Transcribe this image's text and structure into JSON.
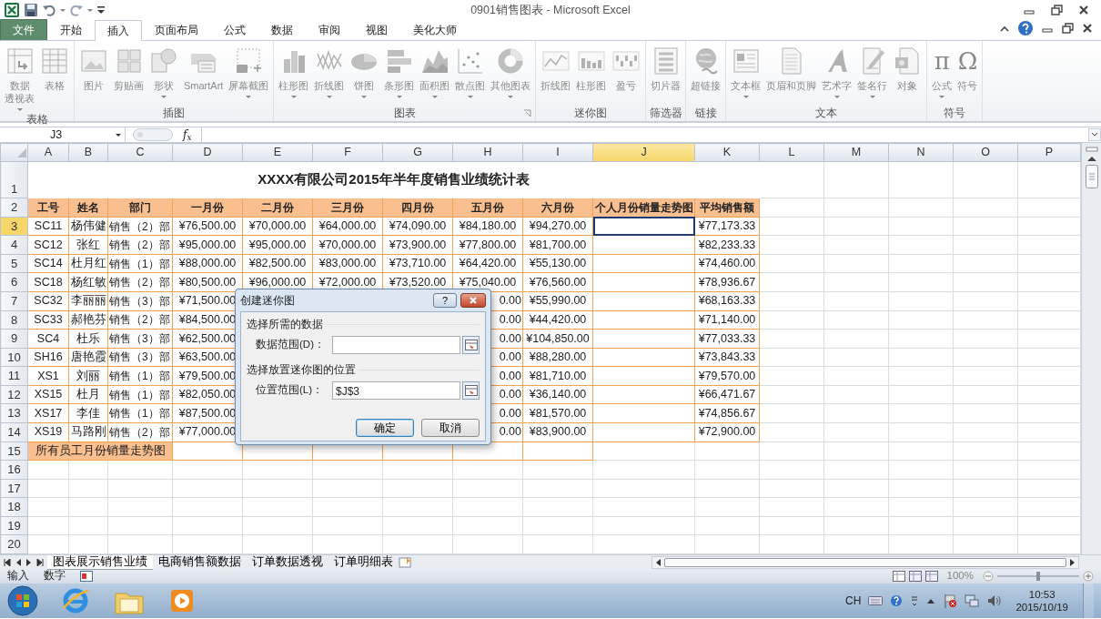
{
  "window": {
    "title": "0901销售图表 - Microsoft Excel"
  },
  "ribbon_tabs": [
    {
      "label": "文件",
      "kind": "file",
      "selected": false
    },
    {
      "label": "开始",
      "kind": "tab",
      "selected": false
    },
    {
      "label": "插入",
      "kind": "tab",
      "selected": true
    },
    {
      "label": "页面布局",
      "kind": "tab",
      "selected": false
    },
    {
      "label": "公式",
      "kind": "tab",
      "selected": false
    },
    {
      "label": "数据",
      "kind": "tab",
      "selected": false
    },
    {
      "label": "审阅",
      "kind": "tab",
      "selected": false
    },
    {
      "label": "视图",
      "kind": "tab",
      "selected": false
    },
    {
      "label": "美化大师",
      "kind": "tab",
      "selected": false
    }
  ],
  "ribbon": {
    "disabled": true,
    "groups": [
      {
        "label": "表格",
        "dialog_launcher": false,
        "buttons": [
          {
            "lines": [
              "数据",
              "透视表"
            ],
            "dropdown": true
          },
          {
            "lines": [
              "表格"
            ],
            "dropdown": false
          }
        ]
      },
      {
        "label": "插图",
        "dialog_launcher": false,
        "buttons": [
          {
            "lines": [
              "图片"
            ],
            "dropdown": false
          },
          {
            "lines": [
              "剪贴画"
            ],
            "dropdown": false
          },
          {
            "lines": [
              "形状"
            ],
            "dropdown": true
          },
          {
            "lines": [
              "SmartArt"
            ],
            "dropdown": false
          },
          {
            "lines": [
              "屏幕截图"
            ],
            "dropdown": true
          }
        ]
      },
      {
        "label": "图表",
        "dialog_launcher": true,
        "buttons": [
          {
            "lines": [
              "柱形图"
            ],
            "dropdown": true
          },
          {
            "lines": [
              "折线图"
            ],
            "dropdown": true
          },
          {
            "lines": [
              "饼图"
            ],
            "dropdown": true
          },
          {
            "lines": [
              "条形图"
            ],
            "dropdown": true
          },
          {
            "lines": [
              "面积图"
            ],
            "dropdown": true
          },
          {
            "lines": [
              "散点图"
            ],
            "dropdown": true
          },
          {
            "lines": [
              "其他图表"
            ],
            "dropdown": true
          }
        ]
      },
      {
        "label": "迷你图",
        "dialog_launcher": false,
        "buttons": [
          {
            "lines": [
              "折线图"
            ],
            "dropdown": false
          },
          {
            "lines": [
              "柱形图"
            ],
            "dropdown": false
          },
          {
            "lines": [
              "盈亏"
            ],
            "dropdown": false
          }
        ]
      },
      {
        "label": "筛选器",
        "dialog_launcher": false,
        "buttons": [
          {
            "lines": [
              "切片器"
            ],
            "dropdown": false
          }
        ]
      },
      {
        "label": "链接",
        "dialog_launcher": false,
        "buttons": [
          {
            "lines": [
              "超链接"
            ],
            "dropdown": false
          }
        ]
      },
      {
        "label": "文本",
        "dialog_launcher": false,
        "buttons": [
          {
            "lines": [
              "文本框"
            ],
            "dropdown": true
          },
          {
            "lines": [
              "页眉和页脚"
            ],
            "dropdown": false
          },
          {
            "lines": [
              "艺术字"
            ],
            "dropdown": true
          },
          {
            "lines": [
              "签名行"
            ],
            "dropdown": true
          },
          {
            "lines": [
              "对象"
            ],
            "dropdown": false
          }
        ]
      },
      {
        "label": "符号",
        "dialog_launcher": false,
        "buttons": [
          {
            "glyph": "π",
            "lines": [
              "公式"
            ],
            "dropdown": true
          },
          {
            "glyph": "Ω",
            "lines": [
              "符号"
            ],
            "dropdown": false
          }
        ]
      }
    ]
  },
  "formula_bar": {
    "name_box": "J3",
    "fx": "f$_{x}$"
  },
  "columns": [
    {
      "label": "A",
      "selected": false
    },
    {
      "label": "B",
      "selected": false
    },
    {
      "label": "C",
      "selected": false
    },
    {
      "label": "D",
      "selected": false
    },
    {
      "label": "E",
      "selected": false
    },
    {
      "label": "F",
      "selected": false
    },
    {
      "label": "G",
      "selected": false
    },
    {
      "label": "H",
      "selected": false
    },
    {
      "label": "I",
      "selected": false
    },
    {
      "label": "J",
      "selected": true
    },
    {
      "label": "K",
      "selected": false
    },
    {
      "label": "L",
      "selected": false
    },
    {
      "label": "M",
      "selected": false
    },
    {
      "label": "N",
      "selected": false
    },
    {
      "label": "O",
      "selected": false
    },
    {
      "label": "P",
      "selected": false
    }
  ],
  "rows": [
    {
      "label": "1",
      "kind": "title",
      "selected": false,
      "title": "XXXX有限公司2015年半年度销售业绩统计表"
    },
    {
      "label": "2",
      "kind": "header",
      "selected": false,
      "cells": [
        "工号",
        "姓名",
        "部门",
        "一月份",
        "二月份",
        "三月份",
        "四月份",
        "五月份",
        "六月份",
        "个人月份销量走势图",
        "平均销售额"
      ]
    },
    {
      "label": "3",
      "kind": "data",
      "selected": true,
      "cells": [
        "SC11",
        "杨伟健",
        "销售（2）部",
        "¥76,500.00",
        "¥70,000.00",
        "¥64,000.00",
        "¥74,090.00",
        "¥84,180.00",
        "¥94,270.00",
        null,
        "¥77,173.33"
      ]
    },
    {
      "label": "4",
      "kind": "data",
      "selected": false,
      "cells": [
        "SC12",
        "张红",
        "销售（2）部",
        "¥95,000.00",
        "¥95,000.00",
        "¥70,000.00",
        "¥73,900.00",
        "¥77,800.00",
        "¥81,700.00",
        null,
        "¥82,233.33"
      ]
    },
    {
      "label": "5",
      "kind": "data",
      "selected": false,
      "cells": [
        "SC14",
        "杜月红",
        "销售（1）部",
        "¥88,000.00",
        "¥82,500.00",
        "¥83,000.00",
        "¥73,710.00",
        "¥64,420.00",
        "¥55,130.00",
        null,
        "¥74,460.00"
      ]
    },
    {
      "label": "6",
      "kind": "data",
      "selected": false,
      "cells": [
        "SC18",
        "杨红敏",
        "销售（2）部",
        "¥80,500.00",
        "¥96,000.00",
        "¥72,000.00",
        "¥73,520.00",
        "¥75,040.00",
        "¥76,560.00",
        null,
        "¥78,936.67"
      ]
    },
    {
      "label": "7",
      "kind": "data",
      "selected": false,
      "cells": [
        "SC32",
        "李丽丽",
        "销售（3）部",
        "¥71,500.00",
        null,
        null,
        null,
        "0.00",
        "¥55,990.00",
        null,
        "¥68,163.33"
      ]
    },
    {
      "label": "8",
      "kind": "data",
      "selected": false,
      "cells": [
        "SC33",
        "郝艳芬",
        "销售（2）部",
        "¥84,500.00",
        null,
        null,
        null,
        "0.00",
        "¥44,420.00",
        null,
        "¥71,140.00"
      ]
    },
    {
      "label": "9",
      "kind": "data",
      "selected": false,
      "cells": [
        "SC4",
        "杜乐",
        "销售（3）部",
        "¥62,500.00",
        null,
        null,
        null,
        "0.00",
        "¥104,850.00",
        null,
        "¥77,033.33"
      ]
    },
    {
      "label": "10",
      "kind": "data",
      "selected": false,
      "cells": [
        "SH16",
        "唐艳霞",
        "销售（3）部",
        "¥63,500.00",
        null,
        null,
        null,
        "0.00",
        "¥88,280.00",
        null,
        "¥73,843.33"
      ]
    },
    {
      "label": "11",
      "kind": "data",
      "selected": false,
      "cells": [
        "XS1",
        "刘丽",
        "销售（1）部",
        "¥79,500.00",
        null,
        null,
        null,
        "0.00",
        "¥81,710.00",
        null,
        "¥79,570.00"
      ]
    },
    {
      "label": "12",
      "kind": "data",
      "selected": false,
      "cells": [
        "XS15",
        "杜月",
        "销售（1）部",
        "¥82,050.00",
        null,
        null,
        null,
        "0.00",
        "¥36,140.00",
        null,
        "¥66,471.67"
      ]
    },
    {
      "label": "13",
      "kind": "data",
      "selected": false,
      "cells": [
        "XS17",
        "李佳",
        "销售（1）部",
        "¥87,500.00",
        null,
        null,
        null,
        "0.00",
        "¥81,570.00",
        null,
        "¥74,856.67"
      ]
    },
    {
      "label": "14",
      "kind": "data",
      "selected": false,
      "cells": [
        "XS19",
        "马路刚",
        "销售（2）部",
        "¥77,000.00",
        null,
        null,
        null,
        "0.00",
        "¥83,900.00",
        null,
        "¥72,900.00"
      ]
    },
    {
      "label": "15",
      "kind": "summary",
      "selected": false,
      "title": "所有员工月份销量走势图"
    },
    {
      "label": "16",
      "kind": "empty",
      "selected": false
    },
    {
      "label": "17",
      "kind": "empty",
      "selected": false
    },
    {
      "label": "18",
      "kind": "empty",
      "selected": false
    },
    {
      "label": "19",
      "kind": "empty",
      "selected": false
    },
    {
      "label": "20",
      "kind": "empty",
      "selected": false
    }
  ],
  "dialog": {
    "title": "创建迷你图",
    "help_button": "?",
    "sections": [
      {
        "label": "选择所需的数据",
        "field_label": "数据范围(D)："
      },
      {
        "label": "选择放置迷你图的位置",
        "field_label": "位置范围(L)：",
        "value": "$J$3"
      }
    ],
    "buttons": [
      {
        "label": "确定",
        "default": true
      },
      {
        "label": "取消",
        "default": false
      }
    ]
  },
  "sheet_tabs": [
    {
      "label": "图表展示销售业绩",
      "selected": true
    },
    {
      "label": "电商销售额数据",
      "selected": false
    },
    {
      "label": "订单数据透视",
      "selected": false
    },
    {
      "label": "订单明细表",
      "selected": false
    }
  ],
  "status_bar": {
    "mode": "输入",
    "num_lock": "数字",
    "zoom": "100%",
    "zoom_slider": {
      "level": 0.5
    }
  },
  "taskbar": {
    "language": "CH",
    "time": "10:53",
    "date": "2015/10/19"
  }
}
